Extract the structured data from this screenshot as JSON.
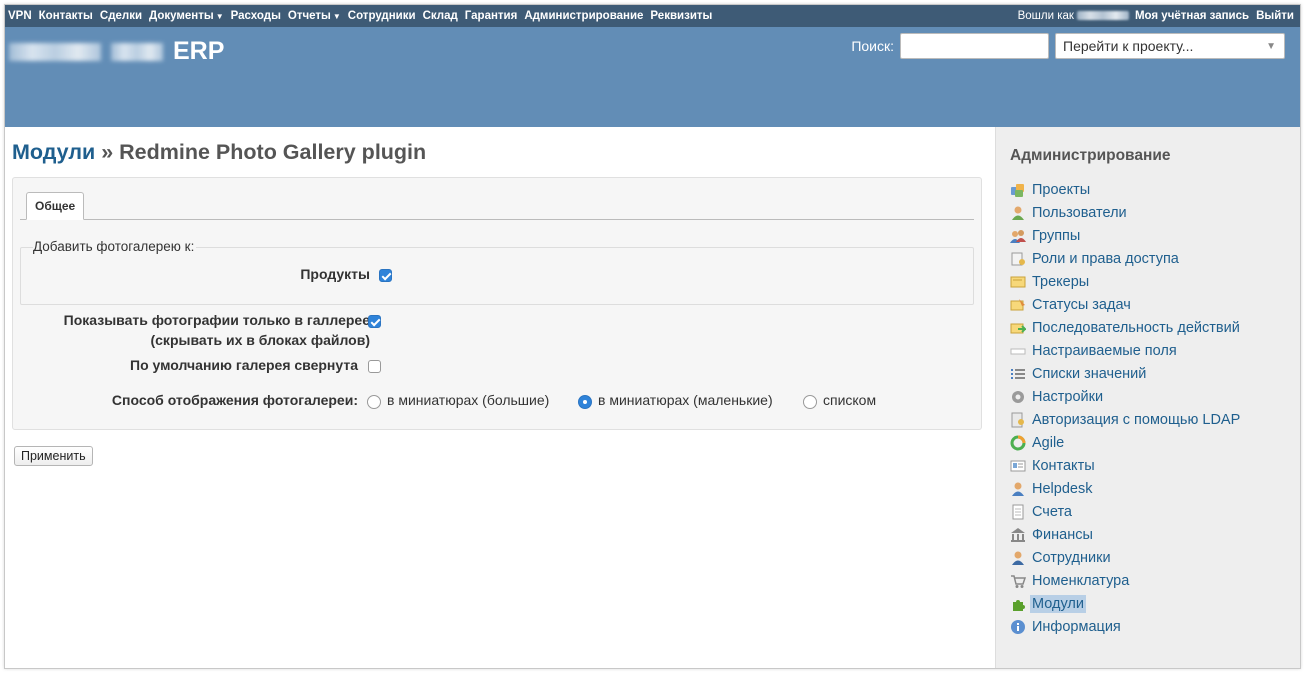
{
  "top_menu": {
    "items": [
      {
        "label": "VPN"
      },
      {
        "label": "Контакты"
      },
      {
        "label": "Сделки"
      },
      {
        "label": "Документы",
        "dropdown": true
      },
      {
        "label": "Расходы"
      },
      {
        "label": "Отчеты",
        "dropdown": true
      },
      {
        "label": "Сотрудники"
      },
      {
        "label": "Склад"
      },
      {
        "label": "Гарантия"
      },
      {
        "label": "Администрирование"
      },
      {
        "label": "Реквизиты"
      }
    ],
    "logged_in_as": "Вошли как",
    "my_account": "Моя учётная запись",
    "logout": "Выйти"
  },
  "header": {
    "app_title": "ERP",
    "search_label": "Поиск:",
    "search_value": "",
    "project_jump": "Перейти к проекту..."
  },
  "page": {
    "breadcrumb_link": "Модули",
    "breadcrumb_sep": "»",
    "title": "Redmine Photo Gallery plugin",
    "tab_general": "Общее",
    "fieldset_legend": "Добавить фотогалерею к:",
    "products_label": "Продукты",
    "products_checked": true,
    "show_only_in_gallery_label": "Показывать фотографии только в галлерее (скрывать их в блоках файлов)",
    "show_only_in_gallery_checked": true,
    "collapsed_default_label": "По умолчанию галерея свернута",
    "collapsed_default_checked": false,
    "display_mode_label": "Способ отображения фотогалереи:",
    "display_options": [
      {
        "label": "в миниатюрах (большие)",
        "selected": false
      },
      {
        "label": "в миниатюрах (маленькие)",
        "selected": true
      },
      {
        "label": "списком",
        "selected": false
      }
    ],
    "apply_button": "Применить"
  },
  "sidebar": {
    "title": "Администрирование",
    "items": [
      {
        "label": "Проекты",
        "icon": "projects-icon"
      },
      {
        "label": "Пользователи",
        "icon": "user-icon"
      },
      {
        "label": "Группы",
        "icon": "group-icon"
      },
      {
        "label": "Роли и права доступа",
        "icon": "roles-icon"
      },
      {
        "label": "Трекеры",
        "icon": "tracker-icon"
      },
      {
        "label": "Статусы задач",
        "icon": "issue-status-icon"
      },
      {
        "label": "Последовательность действий",
        "icon": "workflow-icon"
      },
      {
        "label": "Настраиваемые поля",
        "icon": "custom-fields-icon"
      },
      {
        "label": "Списки значений",
        "icon": "list-icon"
      },
      {
        "label": "Настройки",
        "icon": "gear-icon"
      },
      {
        "label": "Авторизация с помощью LDAP",
        "icon": "ldap-icon"
      },
      {
        "label": "Agile",
        "icon": "agile-icon"
      },
      {
        "label": "Контакты",
        "icon": "contacts-icon"
      },
      {
        "label": "Helpdesk",
        "icon": "helpdesk-icon"
      },
      {
        "label": "Счета",
        "icon": "invoice-icon"
      },
      {
        "label": "Финансы",
        "icon": "finance-icon"
      },
      {
        "label": "Сотрудники",
        "icon": "employees-icon"
      },
      {
        "label": "Номенклатура",
        "icon": "cart-icon"
      },
      {
        "label": "Модули",
        "icon": "plugin-icon",
        "active": true
      },
      {
        "label": "Информация",
        "icon": "info-icon"
      }
    ]
  },
  "colors": {
    "top_menu_bg": "#3e5b76",
    "header_bg": "#628db6",
    "link": "#1f5f8e",
    "sidebar_bg": "#eeeeee",
    "accent": "#2f83d9"
  }
}
